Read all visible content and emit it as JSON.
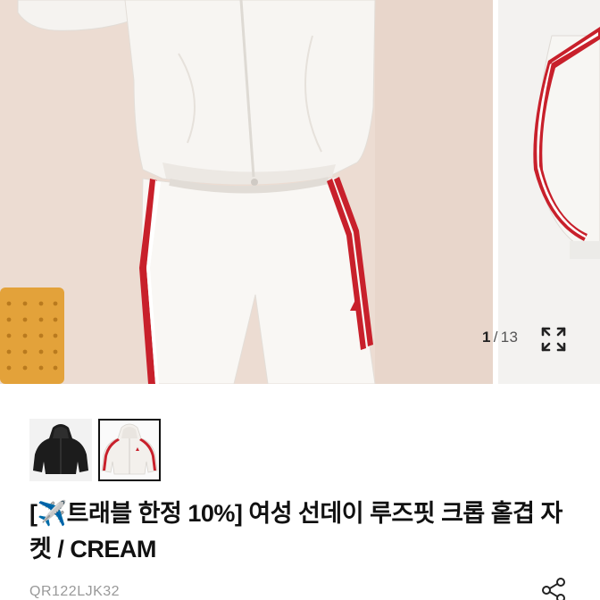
{
  "gallery": {
    "current": "1",
    "separator": "/",
    "total": "13",
    "expand_icon": "expand-fullscreen-icon"
  },
  "thumbnails": [
    {
      "alt": "black hooded cropped jacket",
      "active": false
    },
    {
      "alt": "cream hooded cropped jacket with red stripes",
      "active": true
    }
  ],
  "product": {
    "title_open": "[",
    "title_icon": "✈️",
    "title_text": "트래블 한정 10%] 여성 선데이 루즈핏 크롭 홑겹 자켓 / CREAM",
    "code": "QR122LJK32",
    "share_icon": "share-icon"
  },
  "colors": {
    "stripe_red": "#c8202b",
    "cream": "#f6f3ef",
    "text": "#111111",
    "muted": "#999999"
  }
}
